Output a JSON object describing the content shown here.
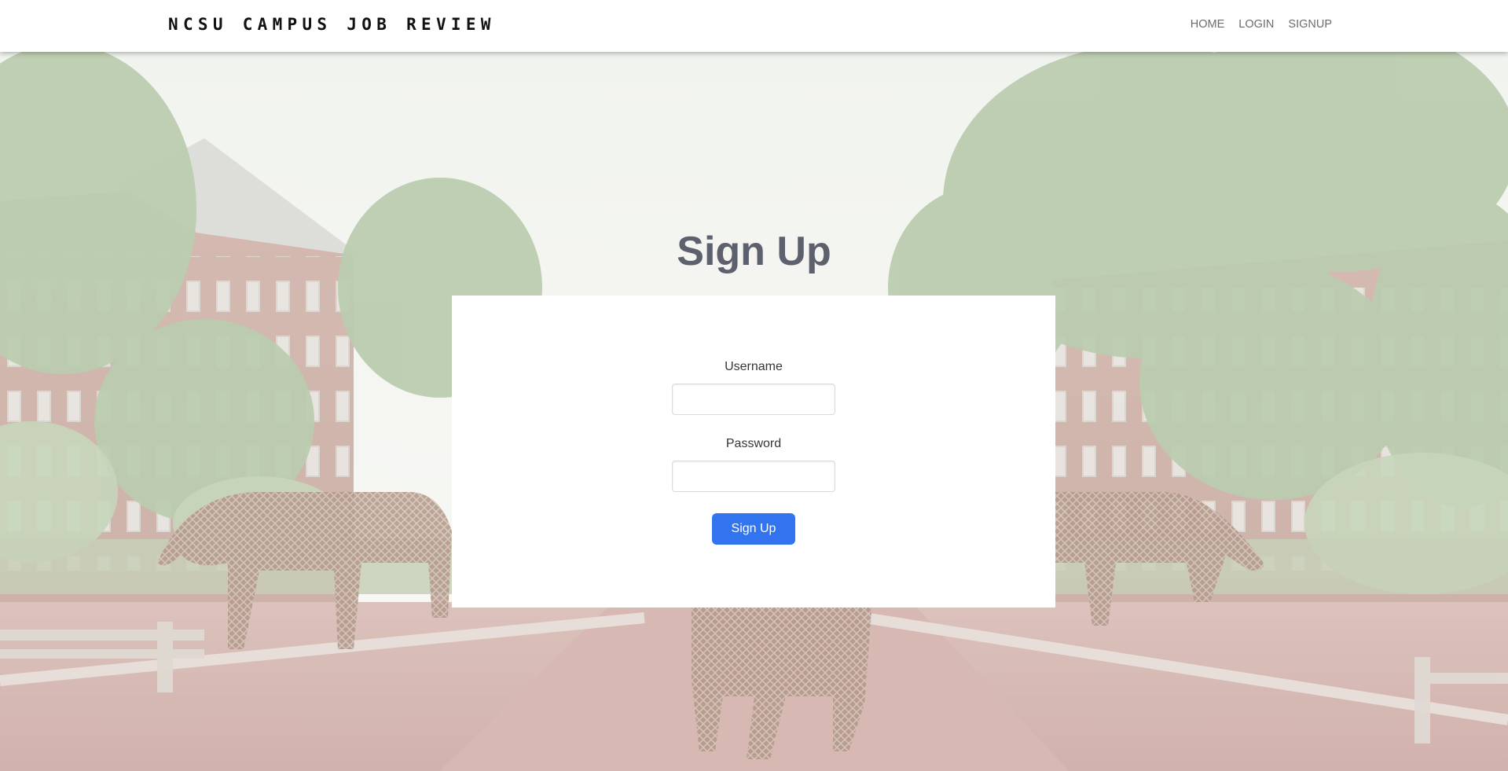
{
  "navbar": {
    "brand": "NCSU CAMPUS JOB REVIEW",
    "links": [
      {
        "label": "HOME"
      },
      {
        "label": "LOGIN"
      },
      {
        "label": "SIGNUP"
      }
    ]
  },
  "hero": {
    "background": "campus courtyard photo with wolf statues (washed-out overlay)"
  },
  "form": {
    "title": "Sign Up",
    "username_label": "Username",
    "username_value": "",
    "password_label": "Password",
    "password_value": "",
    "submit_label": "Sign Up"
  },
  "colors": {
    "accent": "#3273f0",
    "title": "#5c616d",
    "navbar_bg": "#ffffff"
  }
}
